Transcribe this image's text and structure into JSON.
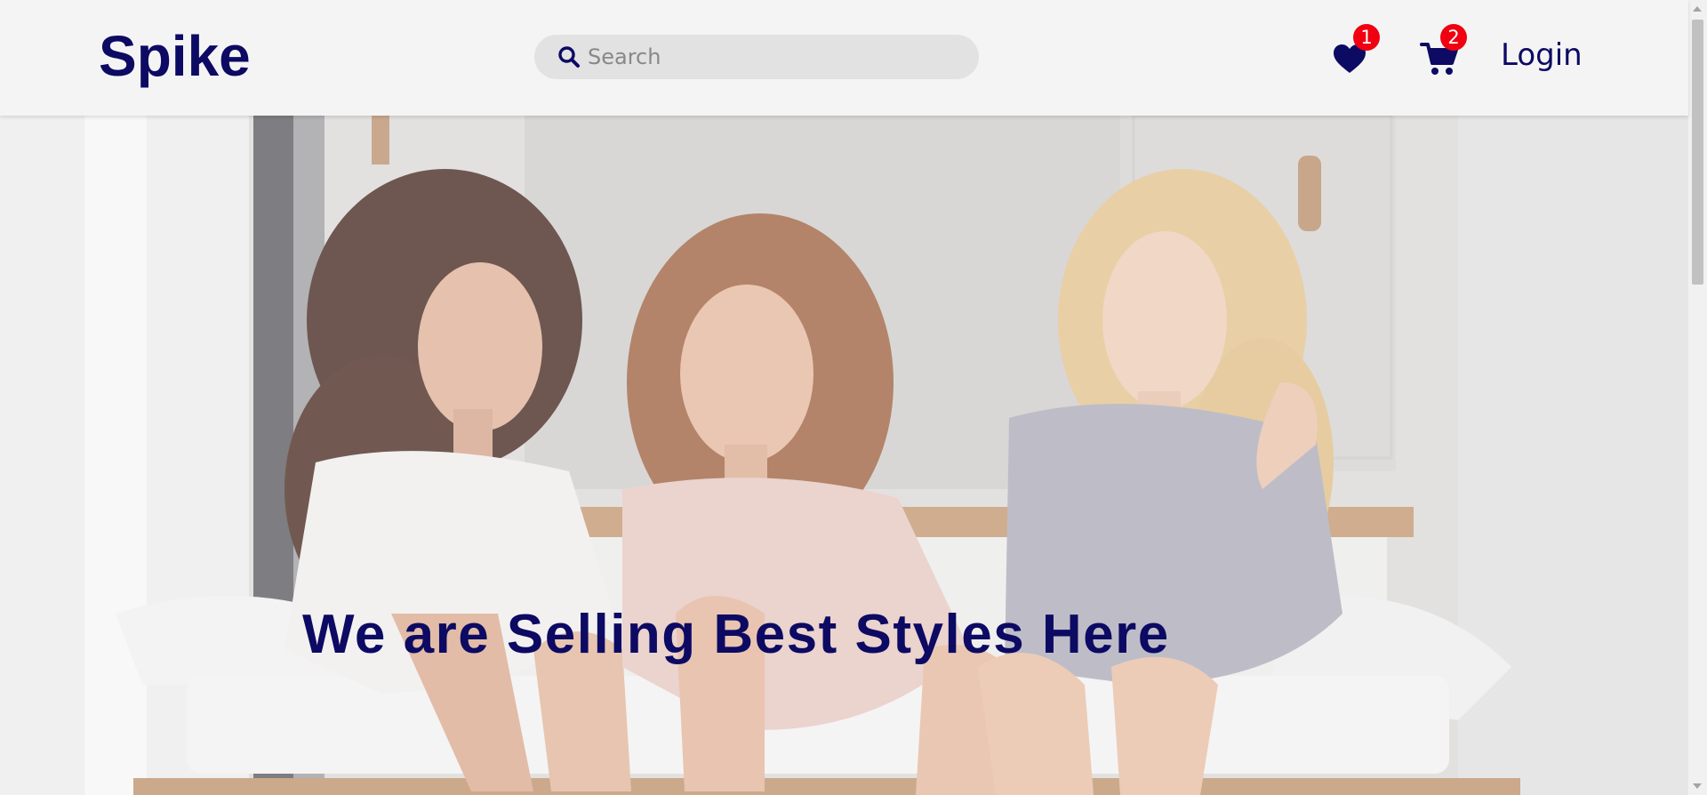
{
  "header": {
    "logo_text": "Spike",
    "search": {
      "placeholder": "Search",
      "value": ""
    },
    "favorites": {
      "icon": "heart-icon",
      "count": "1"
    },
    "cart": {
      "icon": "cart-icon",
      "count": "2"
    },
    "login_label": "Login"
  },
  "hero": {
    "headline": "We are Selling Best Styles Here",
    "image": "photo-three-women-on-bed"
  },
  "colors": {
    "brand": "#0c0a63",
    "badge": "#f00010",
    "header_bg": "#f4f4f4",
    "search_bg": "#e2e2e2"
  }
}
